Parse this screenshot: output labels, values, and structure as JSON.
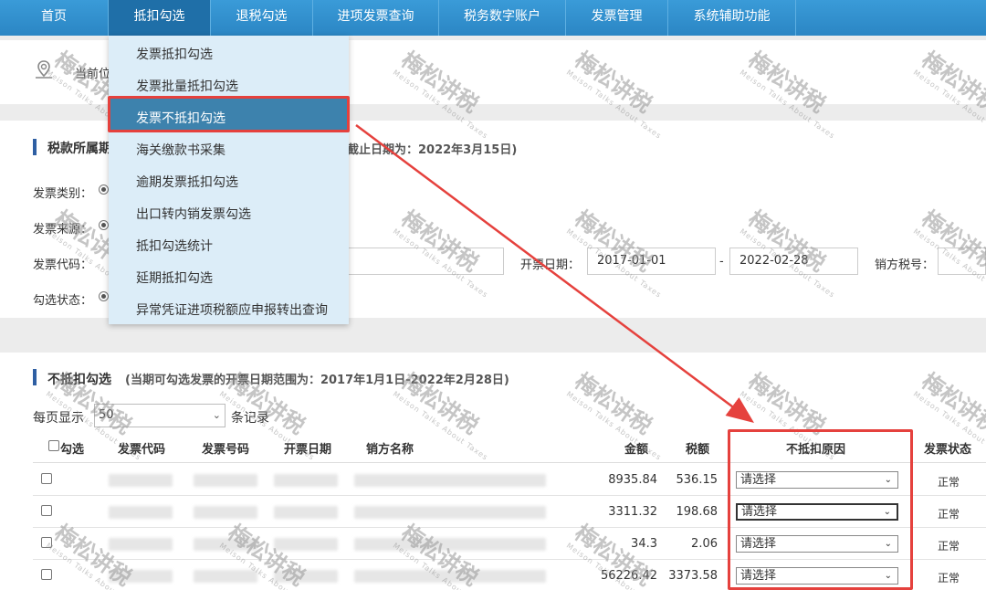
{
  "nav": {
    "items": [
      "首页",
      "抵扣勾选",
      "退税勾选",
      "进项发票查询",
      "税务数字账户",
      "发票管理",
      "系统辅助功能"
    ],
    "active_index": 1
  },
  "breadcrumb": {
    "text": "当前位"
  },
  "dropdown": {
    "items": [
      "发票抵扣勾选",
      "发票批量抵扣勾选",
      "发票不抵扣勾选",
      "海关缴款书采集",
      "逾期发票抵扣勾选",
      "出口转内销发票勾选",
      "抵扣勾选统计",
      "延期抵扣勾选",
      "异常凭证进项税额应申报转出查询"
    ],
    "selected_index": 2
  },
  "tax_period": {
    "title": "税款所属期",
    "note": "截止日期为：2022年3月15日)"
  },
  "filters": {
    "invoice_type_label": "发票类别：",
    "invoice_source_label": "发票来源：",
    "invoice_code_label": "发票代码：",
    "select_status_label": "勾选状态：",
    "issue_date_label": "开票日期：",
    "date_from": "2017-01-01",
    "date_separator": "-",
    "date_to": "2022-02-28",
    "seller_tax_no_label": "销方税号："
  },
  "no_deduct": {
    "title": "不抵扣勾选",
    "note": "(当期可勾选发票的开票日期范围为：2017年1月1日-2022年2月28日)",
    "page_size_label": "每页显示",
    "page_size_value": "50",
    "page_size_suffix": "条记录"
  },
  "table": {
    "headers": [
      "勾选",
      "发票代码",
      "发票号码",
      "开票日期",
      "销方名称",
      "金额",
      "税额",
      "不抵扣原因",
      "发票状态"
    ],
    "rows": [
      {
        "amount": "8935.84",
        "tax": "536.15",
        "reason": "请选择",
        "status": "正常"
      },
      {
        "amount": "3311.32",
        "tax": "198.68",
        "reason": "请选择",
        "status": "正常"
      },
      {
        "amount": "34.3",
        "tax": "2.06",
        "reason": "请选择",
        "status": "正常"
      },
      {
        "amount": "56226.42",
        "tax": "3373.58",
        "reason": "请选择",
        "status": "正常"
      }
    ]
  },
  "watermark": {
    "text": "梅松讲税",
    "subtext": "Meison Talks About Taxes"
  },
  "colors": {
    "nav": "#2b86c4",
    "highlight": "#3d82ad",
    "annotation": "#e5413d"
  },
  "icons": {
    "breadcrumb": "location-pin-icon",
    "select_chevron": "chevron-down-icon"
  }
}
